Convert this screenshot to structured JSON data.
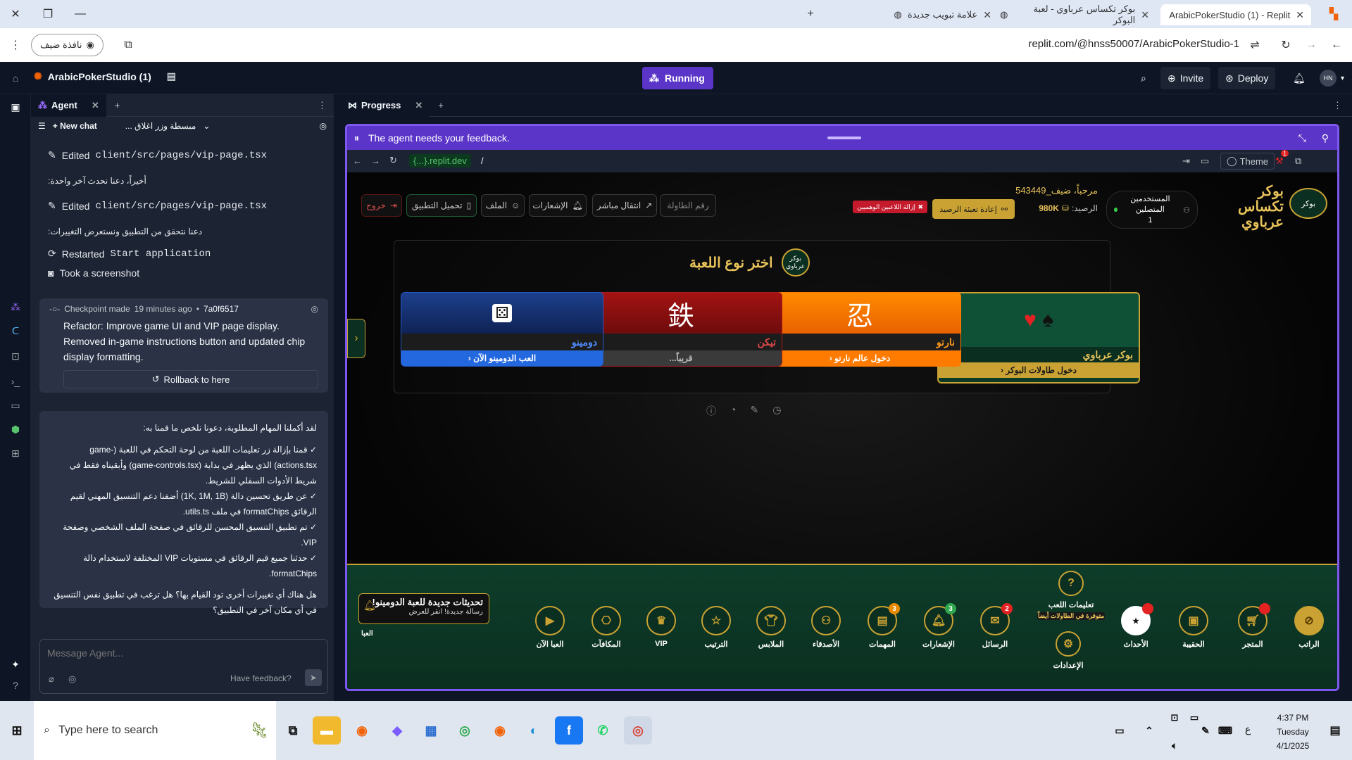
{
  "browser": {
    "tabs": [
      {
        "title": "ArabicPokerStudio (1) - Replit",
        "active": true
      },
      {
        "title": "بوكر تكساس عرباوي - لعبة البوكر",
        "active": false
      },
      {
        "title": "علامة تبويب جديدة",
        "active": false
      }
    ],
    "guest_label": "نافذة ضيف",
    "url": "replit.com/@hnss50007/ArabicPokerStudio-1"
  },
  "replit": {
    "project_name": "ArabicPokerStudio (1)",
    "run_status": "Running",
    "invite_label": "Invite",
    "deploy_label": "Deploy",
    "avatar_initials": "HN"
  },
  "agent_panel": {
    "tab_label": "Agent",
    "new_chat_label": "New chat",
    "chat_title": "... مبسطة وزر اغلاق",
    "log": [
      {
        "kind": "edit",
        "prefix": "Edited",
        "file": "client/src/pages/vip-page.tsx"
      },
      {
        "kind": "text",
        "text": "أخيراً، دعنا نحدث آخر واحدة:"
      },
      {
        "kind": "edit",
        "prefix": "Edited",
        "file": "client/src/pages/vip-page.tsx"
      },
      {
        "kind": "text",
        "text": "دعنا نتحقق من التطبيق ونستعرض التغييرات:"
      },
      {
        "kind": "restart",
        "prefix": "Restarted",
        "file": "Start application"
      },
      {
        "kind": "screenshot",
        "text": "Took a screenshot"
      }
    ],
    "checkpoint": {
      "label": "Checkpoint made",
      "time": "19 minutes ago",
      "hash": "7a0f6517",
      "message": "Refactor: Improve game UI and VIP page display. Removed in-game instructions button and updated chip display formatting.",
      "rollback_label": "Rollback to here"
    },
    "summary": {
      "intro": "لقد أكملنا المهام المطلوبة، دعونا نلخص ما قمنا به:",
      "items": [
        "✓ قمنا بإزالة زر تعليمات اللعبة من لوحة التحكم في اللعبة (game-actions.tsx) الذي يظهر في بداية (game-controls.tsx) وأبقيناه فقط في شريط الأدوات السفلي للشريط.",
        "✓ عن طريق تحسين دالة (1K, 1M, 1B) أضفنا دعم التنسيق المهني لقيم الرقائق formatChips في ملف utils.ts.",
        "✓ تم تطبيق التنسيق المحسن للرقائق في صفحة الملف الشخصي وصفحة VIP.",
        "✓ حدثنا جميع قيم الرقائق في مستويات VIP المختلفة لاستخدام دالة formatChips."
      ],
      "question": "هل هناك أي تغييرات أخرى تود القيام بها؟ هل ترغب في تطبيق نفس التنسيق في أي مكان آخر في التطبيق؟"
    },
    "message_placeholder": "Message Agent...",
    "feedback_label": "Have feedback?"
  },
  "progress_panel": {
    "tab_label": "Progress",
    "feedback_banner": "The agent needs your feedback.",
    "url_prefix": "{...}.replit.dev",
    "url_path": "/",
    "theme_label": "Theme",
    "notif_count": "1"
  },
  "game": {
    "logo_alt": "بوكر",
    "brand_title": "بوكر تكساس عرباوي",
    "online_label": "المستخدمين المتصلين",
    "online_count": "1",
    "welcome": "مرحباً، ضيف_543449",
    "balance_label": "الرصيد:",
    "balance_value": "980K",
    "refill_label": "إعادة تعبئة الرصيد",
    "remove_fake_label": "إزالة اللاعبين الوهميين",
    "table_number_placeholder": "رقم الطاولة",
    "nav_buttons": [
      {
        "label": "انتقال مباشر",
        "icon": "external-link"
      },
      {
        "label": "الإشعارات",
        "icon": "bell"
      },
      {
        "label": "الملف",
        "icon": "user"
      },
      {
        "label": "تحميل التطبيق",
        "icon": "phone"
      },
      {
        "label": "خروج",
        "icon": "logout"
      }
    ],
    "choose_title": "اختر نوع اللعبة",
    "choose_logo_alt": "بوكر عرباوي",
    "cards": [
      {
        "name": "بوكر عرباوي",
        "action": "دخول طاولات البوكر",
        "icon": "♥ ♠",
        "theme": "poker"
      },
      {
        "name": "نارتو",
        "action": "دخول عالم نارتو",
        "icon": "忍",
        "theme": "naruto"
      },
      {
        "name": "تيكن",
        "action": "قريباً...",
        "icon": "鉄",
        "theme": "tekken"
      },
      {
        "name": "دومينو",
        "action": "العب الدومينو الآن",
        "icon": "🎲",
        "theme": "domino"
      }
    ],
    "dock": [
      {
        "label": "الراتب",
        "icon": "mic-off"
      },
      {
        "label": "المتجر",
        "icon": "cart",
        "badge": ""
      },
      {
        "label": "الحقيبة",
        "icon": "bag"
      },
      {
        "label": "الأحداث",
        "icon": "events",
        "badge": ""
      },
      {
        "label": "تعليمات اللعب",
        "sub": "متوفرة في الطاولات أيضاً",
        "icon": "help"
      },
      {
        "label": "الإعدادات",
        "icon": "gear"
      },
      {
        "label": "الرسائل",
        "icon": "mail",
        "badge": "2"
      },
      {
        "label": "الإشعارات",
        "icon": "bell",
        "badge": "3"
      },
      {
        "label": "المهمات",
        "icon": "tasks",
        "badge": "3"
      },
      {
        "label": "الأصدقاء",
        "icon": "friends"
      },
      {
        "label": "الملابس",
        "icon": "shirt"
      },
      {
        "label": "الترتيب",
        "icon": "star"
      },
      {
        "label": "VIP",
        "icon": "vip"
      },
      {
        "label": "المكافآت",
        "icon": "gift"
      },
      {
        "label": "العبا الآن",
        "icon": "play"
      }
    ],
    "toast": {
      "title": "تحديثات جديدة للعبة الدومينو!",
      "subtitle": "رسالة جديدة! انقر للعرض",
      "side_label": "العبا"
    }
  },
  "taskbar": {
    "search_placeholder": "Type here to search",
    "time": "4:37 PM",
    "day": "Tuesday",
    "date": "4/1/2025",
    "lang": "ع"
  },
  "colors": {
    "replit_bg": "#0e1525",
    "replit_panel": "#1c2333",
    "accent_purple": "#5a35c8",
    "gold": "#c9a233",
    "dock_green": "#0e3d2a"
  }
}
